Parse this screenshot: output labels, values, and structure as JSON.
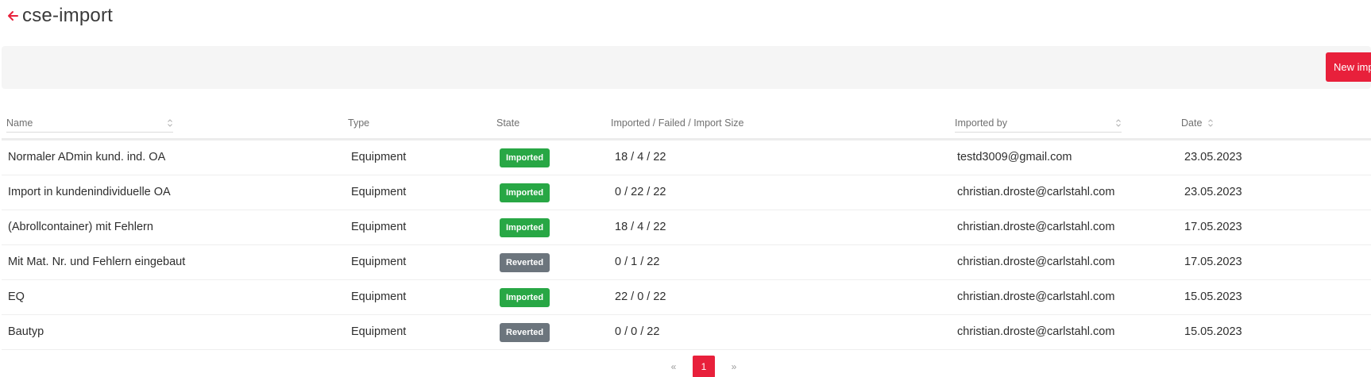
{
  "header": {
    "title": "cse-import",
    "back_icon": "arrow-left-icon",
    "accent_color": "#e8203b"
  },
  "toolbar": {
    "new_import_label": "New import"
  },
  "table": {
    "columns": {
      "name": "Name",
      "type": "Type",
      "state": "State",
      "counts": "Imported / Failed / Import Size",
      "imported_by": "Imported by",
      "date": "Date"
    },
    "rows": [
      {
        "name": "Normaler ADmin kund. ind. OA",
        "type": "Equipment",
        "state": "Imported",
        "counts": "18 / 4 / 22",
        "imported_by": "testd3009@gmail.com",
        "date": "23.05.2023"
      },
      {
        "name": "Import in kundenindividuelle OA",
        "type": "Equipment",
        "state": "Imported",
        "counts": "0 / 22 / 22",
        "imported_by": "christian.droste@carlstahl.com",
        "date": "23.05.2023"
      },
      {
        "name": "(Abrollcontainer) mit Fehlern",
        "type": "Equipment",
        "state": "Imported",
        "counts": "18 / 4 / 22",
        "imported_by": "christian.droste@carlstahl.com",
        "date": "17.05.2023"
      },
      {
        "name": "Mit Mat. Nr. und Fehlern eingebaut",
        "type": "Equipment",
        "state": "Reverted",
        "counts": "0 / 1 / 22",
        "imported_by": "christian.droste@carlstahl.com",
        "date": "17.05.2023"
      },
      {
        "name": "EQ",
        "type": "Equipment",
        "state": "Imported",
        "counts": "22 / 0 / 22",
        "imported_by": "christian.droste@carlstahl.com",
        "date": "15.05.2023"
      },
      {
        "name": "Bautyp",
        "type": "Equipment",
        "state": "Reverted",
        "counts": "0 / 0 / 22",
        "imported_by": "christian.droste@carlstahl.com",
        "date": "15.05.2023"
      }
    ],
    "status_colors": {
      "Imported": "#28a745",
      "Reverted": "#6c757d"
    }
  },
  "pagination": {
    "prev": "«",
    "current": "1",
    "next": "»"
  }
}
